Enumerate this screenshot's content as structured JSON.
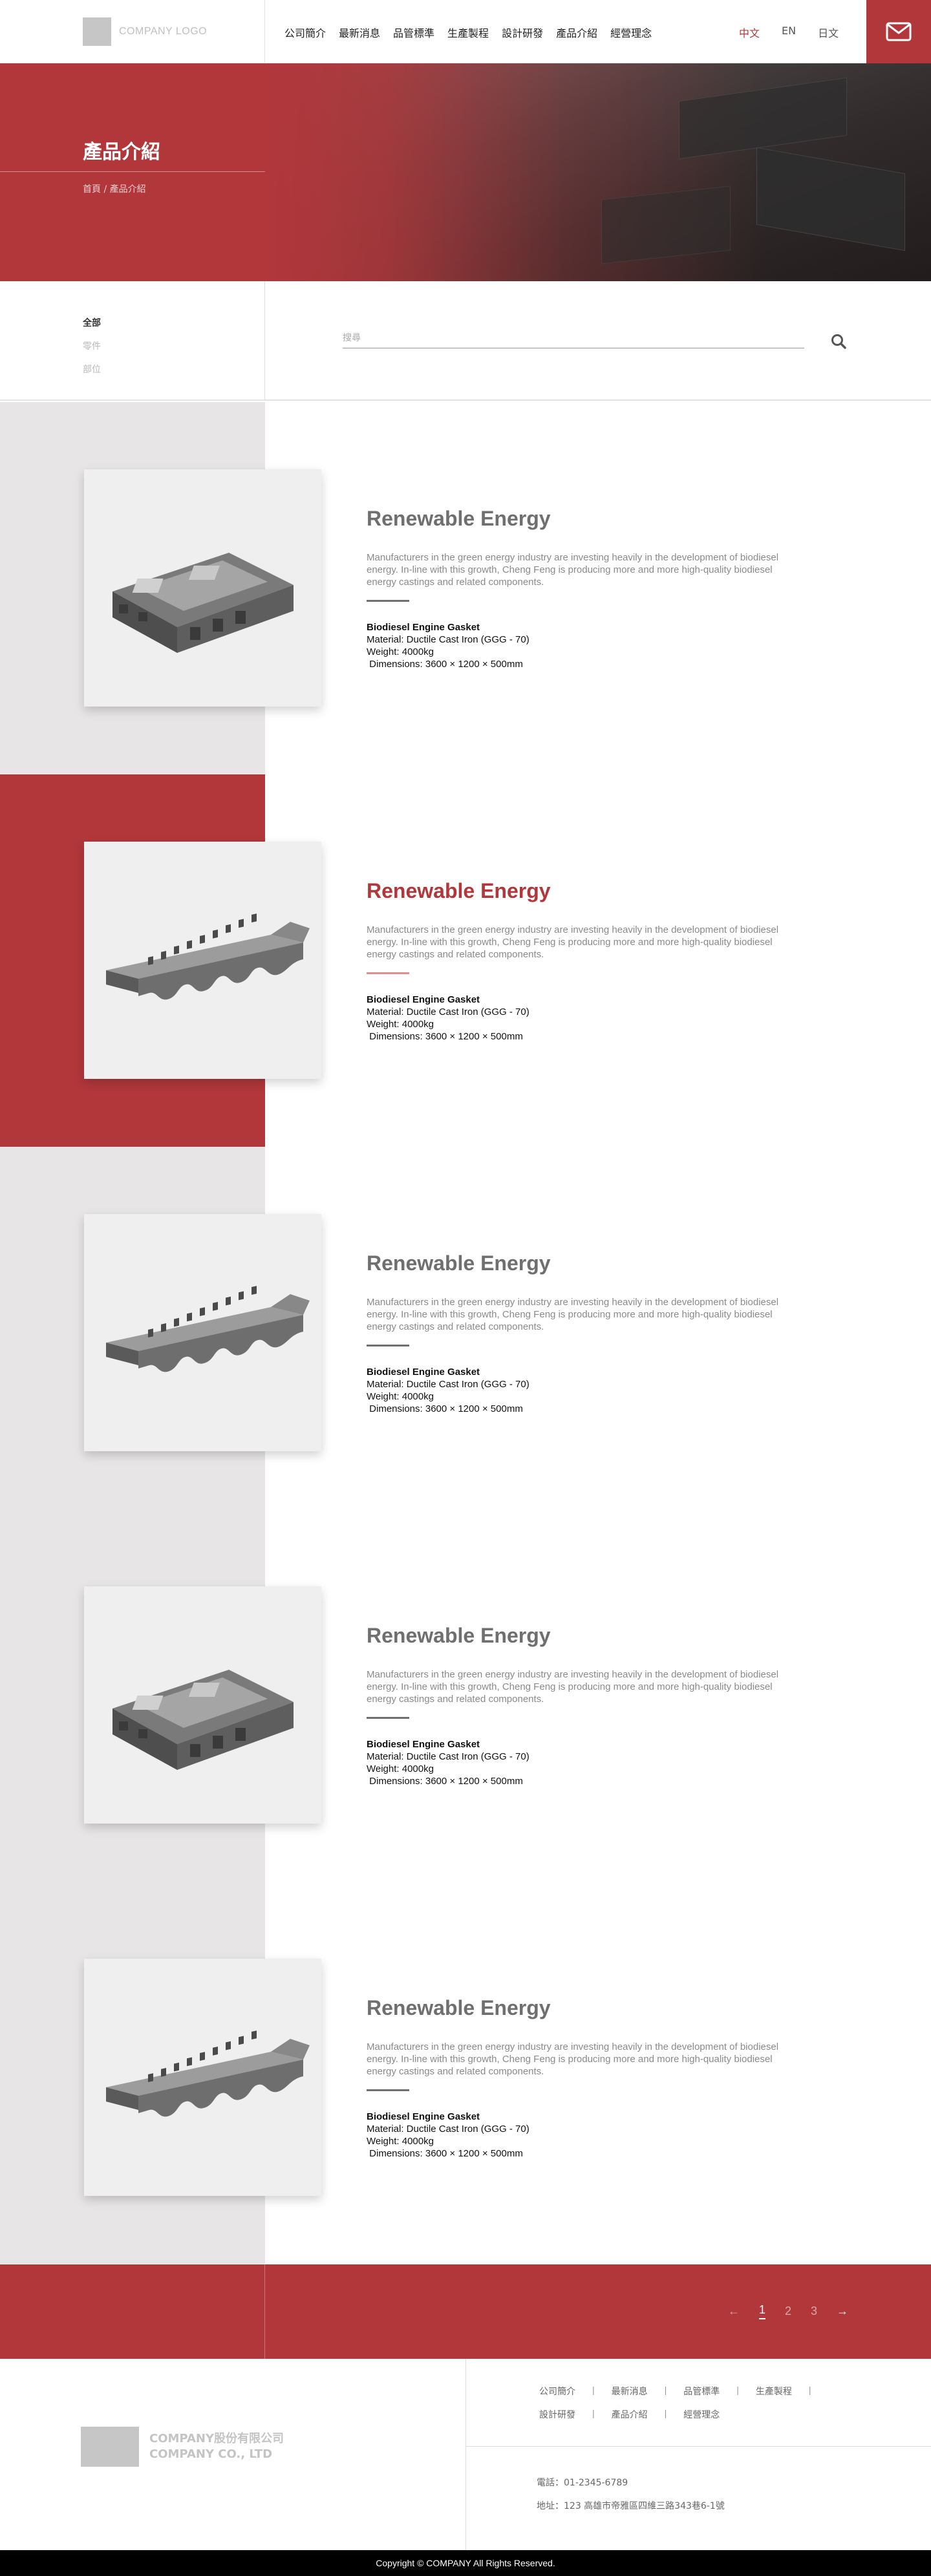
{
  "header": {
    "logo_text": "COMPANY LOGO",
    "nav": [
      "公司簡介",
      "最新消息",
      "品管標準",
      "生產製程",
      "設計研發",
      "產品介紹",
      "經營理念"
    ],
    "languages": [
      "中文",
      "EN",
      "日文"
    ],
    "active_language": "中文",
    "mail_icon": "envelope-icon"
  },
  "hero": {
    "title": "產品介紹",
    "breadcrumb": "首頁 / 產品介紹"
  },
  "filter": {
    "categories": [
      "全部",
      "零件",
      "部位"
    ],
    "active_category": "全部",
    "search_placeholder": "搜尋",
    "search_icon": "magnifier-icon"
  },
  "products": [
    {
      "title": "Renewable Energy",
      "description": "Manufacturers in the green energy industry are investing heavily in the development of biodiesel energy. In-line with this growth, Cheng Feng is producing more and more high-quality biodiesel energy castings and related components.",
      "spec_name": "Biodiesel Engine Gasket",
      "material": "Material: Ductile Cast Iron (GGG - 70)",
      "weight": "Weight: 4000kg",
      "dimensions": " Dimensions: 3600 × 1200 × 500mm",
      "image": "frame-casting"
    },
    {
      "title": "Renewable Energy",
      "description": "Manufacturers in the green energy industry are investing heavily in the development of biodiesel energy. In-line with this growth, Cheng Feng is producing more and more high-quality biodiesel energy castings and related components.",
      "spec_name": "Biodiesel Engine Gasket",
      "material": "Material: Ductile Cast Iron (GGG - 70)",
      "weight": "Weight: 4000kg",
      "dimensions": " Dimensions: 3600 × 1200 × 500mm",
      "image": "gasket-casting"
    },
    {
      "title": "Renewable Energy",
      "description": "Manufacturers in the green energy industry are investing heavily in the development of biodiesel energy. In-line with this growth, Cheng Feng is producing more and more high-quality biodiesel energy castings and related components.",
      "spec_name": "Biodiesel Engine Gasket",
      "material": "Material: Ductile Cast Iron (GGG - 70)",
      "weight": "Weight: 4000kg",
      "dimensions": " Dimensions: 3600 × 1200 × 500mm",
      "image": "gasket-casting"
    },
    {
      "title": "Renewable Energy",
      "description": "Manufacturers in the green energy industry are investing heavily in the development of biodiesel energy. In-line with this growth, Cheng Feng is producing more and more high-quality biodiesel energy castings and related components.",
      "spec_name": "Biodiesel Engine Gasket",
      "material": "Material: Ductile Cast Iron (GGG - 70)",
      "weight": "Weight: 4000kg",
      "dimensions": " Dimensions: 3600 × 1200 × 500mm",
      "image": "frame-casting"
    },
    {
      "title": "Renewable Energy",
      "description": "Manufacturers in the green energy industry are investing heavily in the development of biodiesel energy. In-line with this growth, Cheng Feng is producing more and more high-quality biodiesel energy castings and related components.",
      "spec_name": "Biodiesel Engine Gasket",
      "material": "Material: Ductile Cast Iron (GGG - 70)",
      "weight": "Weight: 4000kg",
      "dimensions": " Dimensions: 3600 × 1200 × 500mm",
      "image": "gasket-casting"
    }
  ],
  "highlighted_product_index": 1,
  "pagination": {
    "prev": "←",
    "pages": [
      "1",
      "2",
      "3"
    ],
    "active_page": "1",
    "next": "→"
  },
  "footer": {
    "company_name_zh": "COMPANY股份有限公司",
    "company_name_en": "COMPANY CO., LTD",
    "nav_row1": [
      "公司簡介",
      "最新消息",
      "品管標準",
      "生產製程"
    ],
    "nav_row2": [
      "設計研發",
      "產品介紹",
      "經營理念"
    ],
    "separator": "|",
    "phone": "電話：01-2345-6789",
    "address": "地址：123 高雄市帝雅區四維三路343巷6-1號"
  },
  "copyright": "Copyright © COMPANY All Rights Reserved."
}
